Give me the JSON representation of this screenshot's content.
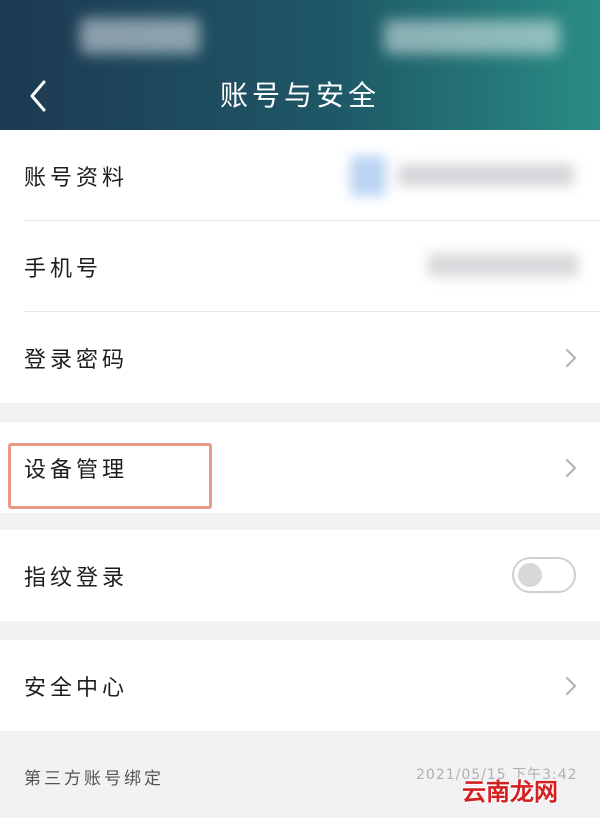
{
  "header": {
    "title": "账号与安全"
  },
  "groups": [
    {
      "rows": [
        {
          "label": "账号资料"
        },
        {
          "label": "手机号"
        },
        {
          "label": "登录密码"
        }
      ]
    },
    {
      "rows": [
        {
          "label": "设备管理"
        }
      ]
    },
    {
      "rows": [
        {
          "label": "指纹登录",
          "toggle_on": false
        }
      ]
    },
    {
      "rows": [
        {
          "label": "安全中心"
        }
      ]
    }
  ],
  "footer": {
    "section_label": "第三方账号绑定",
    "timestamp": "2021/05/15 下午3:42"
  },
  "watermark": "云南龙网",
  "colors": {
    "header_start": "#1d3a52",
    "header_end": "#2a8c84",
    "highlight": "#e89a86"
  },
  "icons": {
    "back": "chevron-left-icon",
    "row_arrow": "chevron-right-icon"
  }
}
